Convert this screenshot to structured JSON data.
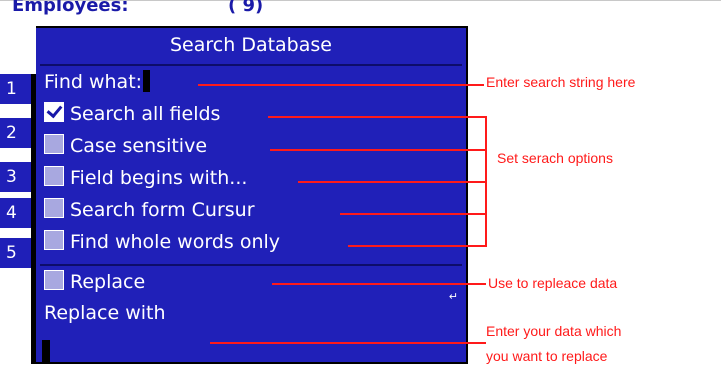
{
  "background": {
    "header_title": "Employees:",
    "header_count": "( 9)",
    "row_numbers": [
      "1",
      "2",
      "3",
      "4",
      "5"
    ]
  },
  "dialog": {
    "title": "Search Database",
    "find_label": "Find what:",
    "options": [
      {
        "label": "Search all fields",
        "checked": true
      },
      {
        "label": "Case sensitive",
        "checked": false
      },
      {
        "label": "Field begins with...",
        "checked": false
      },
      {
        "label": "Search form Cursur",
        "checked": false
      },
      {
        "label": "Find whole words only",
        "checked": false
      }
    ],
    "replace_label": "Replace",
    "replace_checked": false,
    "replace_with_label": "Replace with"
  },
  "annotations": {
    "find": "Enter search string here",
    "options": "Set serach options",
    "replace": "Use to repleace data",
    "replace_with_line1": "Enter your data which",
    "replace_with_line2": "you want to replace"
  },
  "colors": {
    "dialog_bg": "#2020b8",
    "annotation": "#ff1a1a",
    "header_text": "#1a1aa8"
  }
}
